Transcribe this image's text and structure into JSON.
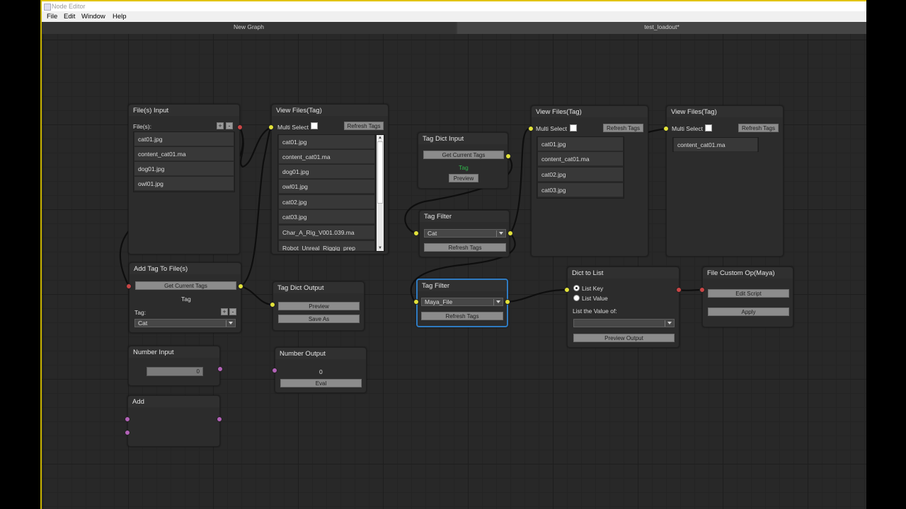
{
  "window": {
    "title": "Node Editor"
  },
  "menu": [
    "File",
    "Edit",
    "Window",
    "Help"
  ],
  "tabs": [
    "New Graph",
    "test_loadout*"
  ],
  "nodes": {
    "files_input": {
      "title": "File(s) Input",
      "label": "File(s):",
      "plus": "+",
      "minus": "-",
      "files": [
        "cat01.jpg",
        "content_cat01.ma",
        "dog01.jpg",
        "owl01.jpg"
      ]
    },
    "view1": {
      "title": "View Files(Tag)",
      "multi": "Multi Select",
      "refresh": "Refresh Tags",
      "files": [
        "cat01.jpg",
        "content_cat01.ma",
        "dog01.jpg",
        "owl01.jpg",
        "cat02.jpg",
        "cat03.jpg",
        "Char_A_Rig_V001.039.ma",
        "Robot_Unreal_Riggig_prep"
      ]
    },
    "tag_dict_input": {
      "title": "Tag Dict Input",
      "get": "Get Current Tags",
      "tag": "Tag",
      "preview": "Preview"
    },
    "tag_filter1": {
      "title": "Tag Filter",
      "value": "Cat",
      "refresh": "Refresh Tags"
    },
    "view2": {
      "title": "View Files(Tag)",
      "multi": "Multi Select",
      "refresh": "Refresh Tags",
      "files": [
        "cat01.jpg",
        "content_cat01.ma",
        "cat02.jpg",
        "cat03.jpg"
      ]
    },
    "view3": {
      "title": "View Files(Tag)",
      "multi": "Multi Select",
      "refresh": "Refresh Tags",
      "files": [
        "content_cat01.ma"
      ]
    },
    "add_tag": {
      "title": "Add Tag To File(s)",
      "get": "Get Current Tags",
      "tag_text": "Tag",
      "tag_label": "Tag:",
      "plus": "+",
      "minus": "-",
      "value": "Cat"
    },
    "tag_dict_output": {
      "title": "Tag Dict Output",
      "preview": "Preview",
      "save": "Save As"
    },
    "tag_filter2": {
      "title": "Tag Filter",
      "value": "Maya_File",
      "refresh": "Refresh Tags"
    },
    "dict_to_list": {
      "title": "Dict to List",
      "opt1": "List Key",
      "opt2": "List Value",
      "label": "List the Value of:",
      "preview": "Preview Output"
    },
    "file_custom": {
      "title": "File Custom Op(Maya)",
      "edit": "Edit Script",
      "apply": "Apply"
    },
    "number_input": {
      "title": "Number Input",
      "value": "0"
    },
    "number_output": {
      "title": "Number Output",
      "value": "0",
      "eval": "Eval"
    },
    "add": {
      "title": "Add"
    }
  },
  "colors": {
    "port_yellow": "#e2e23a",
    "port_red": "#c94545",
    "port_magenta": "#b362b8",
    "selection": "#2f7bc1",
    "tag_text_green": "#2fb34a"
  }
}
